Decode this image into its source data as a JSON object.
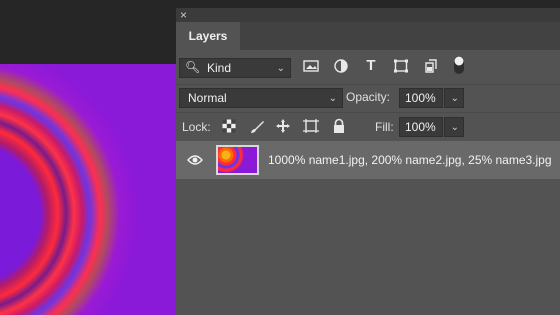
{
  "panel": {
    "close_label": "×",
    "tab_label": "Layers",
    "filter": {
      "label": "Kind",
      "icons": [
        "image-filter-icon",
        "adjustment-filter-icon",
        "type-filter-icon",
        "shape-filter-icon",
        "smart-object-filter-icon",
        "filter-toggle-icon"
      ]
    },
    "blend_mode": "Normal",
    "opacity": {
      "label": "Opacity:",
      "value": "100%"
    },
    "lock": {
      "label": "Lock:",
      "icons": [
        "lock-transparent-icon",
        "lock-image-icon",
        "lock-position-icon",
        "lock-artboard-icon",
        "lock-all-icon"
      ]
    },
    "fill": {
      "label": "Fill:",
      "value": "100%"
    },
    "layer": {
      "name": "1000% name1.jpg, 200% name2.jpg, 25% name3.jpg"
    }
  },
  "colors": {
    "panel_bg": "#535353",
    "selected_layer": "#696969",
    "canvas_bg": "#262626"
  }
}
